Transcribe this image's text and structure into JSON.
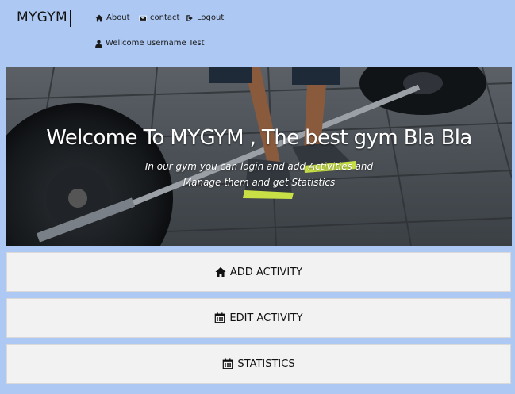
{
  "brand": "MYGYM",
  "nav": {
    "about": "About",
    "contact": "contact",
    "logout": "Logout"
  },
  "welcome_user": "Wellcome username Test",
  "hero": {
    "title": "Welcome To MYGYM , The best gym Bla Bla",
    "subtitle_line1": "In our gym you can login and add Activities and",
    "subtitle_line2": "Manage them and get Statistics"
  },
  "actions": {
    "add": "ADD ACTIVITY",
    "edit": "EDIT ACTIVITY",
    "stats": "STATISTICS"
  },
  "icons": {
    "about": "home-icon",
    "contact": "envelope-icon",
    "logout": "sign-out-icon",
    "user": "user-icon",
    "add": "home-icon",
    "edit": "calendar-icon",
    "stats": "calendar-icon"
  },
  "colors": {
    "background": "#adc8f2",
    "button_bg": "#f2f2f2"
  }
}
